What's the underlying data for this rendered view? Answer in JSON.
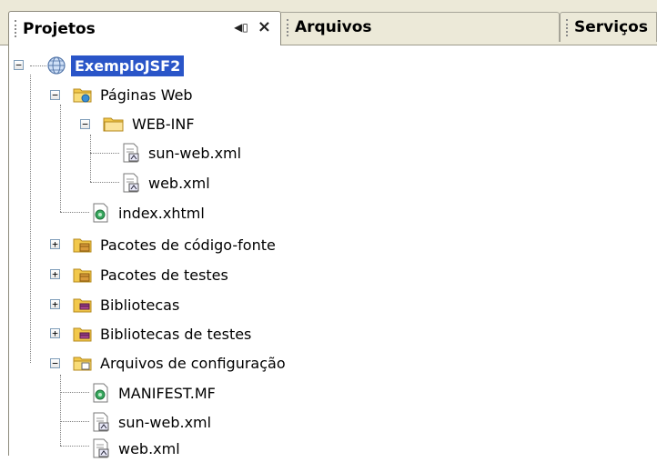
{
  "tabs": [
    {
      "label": "Projetos",
      "active": true
    },
    {
      "label": "Arquivos",
      "active": false
    },
    {
      "label": "Serviços",
      "active": false
    }
  ],
  "tab_controls": {
    "minimize": "◀▯",
    "close": "×"
  },
  "tree": {
    "root": "ExemploJSF2",
    "web_pages": "Páginas Web",
    "web_inf": "WEB-INF",
    "sun_web_xml": "sun-web.xml",
    "web_xml": "web.xml",
    "index": "index.xhtml",
    "source_packages": "Pacotes de código-fonte",
    "test_packages": "Pacotes de testes",
    "libraries": "Bibliotecas",
    "test_libraries": "Bibliotecas de testes",
    "config_files": "Arquivos de configuração",
    "manifest": "MANIFEST.MF",
    "sun_web_xml_2": "sun-web.xml",
    "web_xml_2": "web.xml"
  },
  "colors": {
    "selection": "#2a55c8",
    "folder": "#f2c84b",
    "tab_bg": "#ece9d8"
  }
}
